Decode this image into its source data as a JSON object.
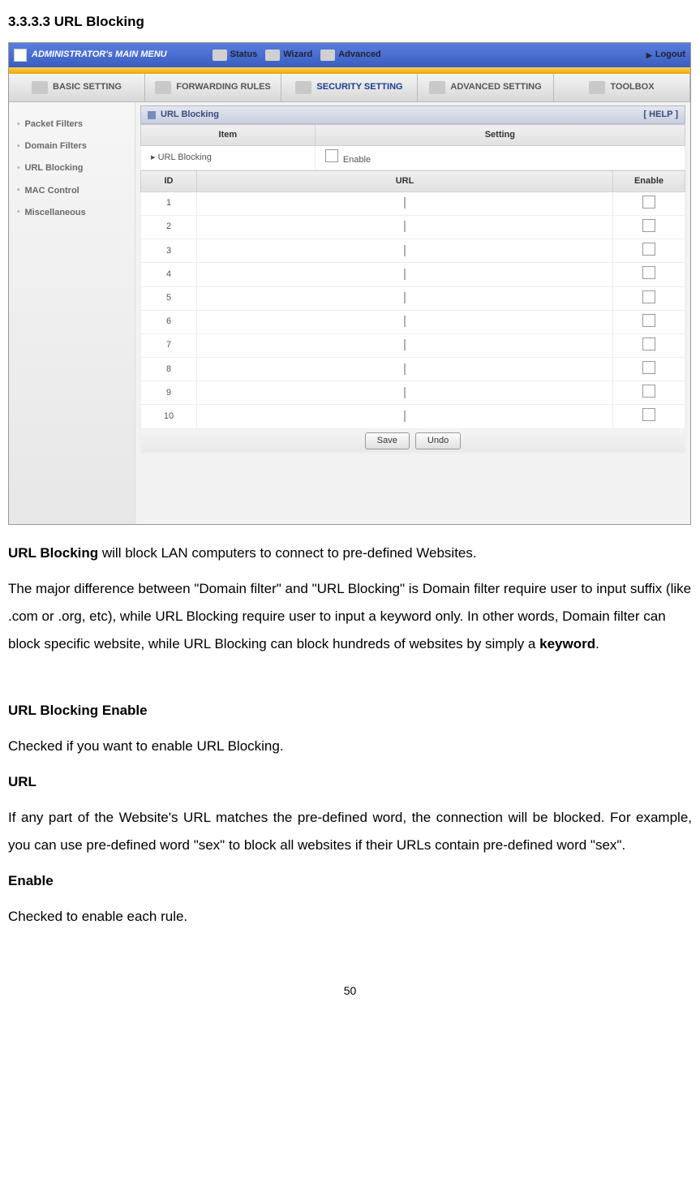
{
  "section_number": "3.3.3.3 URL Blocking",
  "screenshot": {
    "topbar": {
      "main_menu": "ADMINISTRATOR's MAIN MENU",
      "nav": [
        "Status",
        "Wizard",
        "Advanced"
      ],
      "logout": "Logout"
    },
    "tabs": [
      "BASIC SETTING",
      "FORWARDING RULES",
      "SECURITY SETTING",
      "ADVANCED SETTING",
      "TOOLBOX"
    ],
    "active_tab_index": 2,
    "sidebar": [
      "Packet Filters",
      "Domain Filters",
      "URL Blocking",
      "MAC Control",
      "Miscellaneous"
    ],
    "panel_title": "URL Blocking",
    "help_label": "[ HELP ]",
    "header_item": "Item",
    "header_setting": "Setting",
    "row_label": "URL Blocking",
    "enable_label": "Enable",
    "col_id": "ID",
    "col_url": "URL",
    "col_enable": "Enable",
    "ids": [
      "1",
      "2",
      "3",
      "4",
      "5",
      "6",
      "7",
      "8",
      "9",
      "10"
    ],
    "btn_save": "Save",
    "btn_undo": "Undo"
  },
  "text": {
    "p1a": "URL Blocking",
    "p1b": " will block LAN computers to connect to pre-defined Websites.",
    "p2": "The major difference between \"Domain filter\" and \"URL Blocking\" is Domain filter require user to input suffix (like .com or .org, etc), while URL Blocking require user to input a keyword only. In other words, Domain filter can block specific website, while URL Blocking can block hundreds of websites by simply a ",
    "p2b": "keyword",
    "p2c": ".",
    "h1": "URL Blocking Enable",
    "p3": "Checked if you want to enable URL Blocking.",
    "h2": "URL",
    "p4": "If any part of the Website's URL matches the pre-defined word, the connection will be blocked. For example, you can use pre-defined word \"sex\" to block all websites if their URLs contain pre-defined word \"sex\".",
    "h3": "Enable",
    "p5": "Checked to enable each rule."
  },
  "page_number": "50"
}
